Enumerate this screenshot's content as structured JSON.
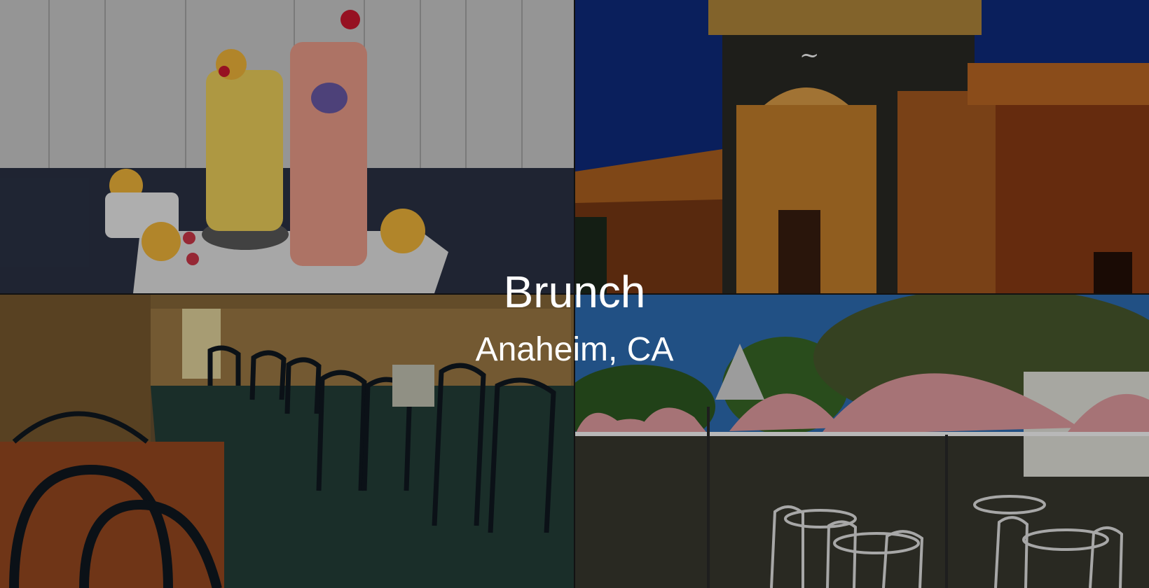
{
  "hero": {
    "title": "Brunch",
    "subtitle": "Anaheim, CA"
  },
  "tiles": [
    {
      "subject": "drinks-photo"
    },
    {
      "subject": "restaurant-exterior-photo"
    },
    {
      "subject": "dining-room-photo"
    },
    {
      "subject": "patio-umbrellas-photo"
    }
  ],
  "colors": {
    "text": "#ffffff",
    "overlay": "rgba(0,0,0,0.28)"
  }
}
